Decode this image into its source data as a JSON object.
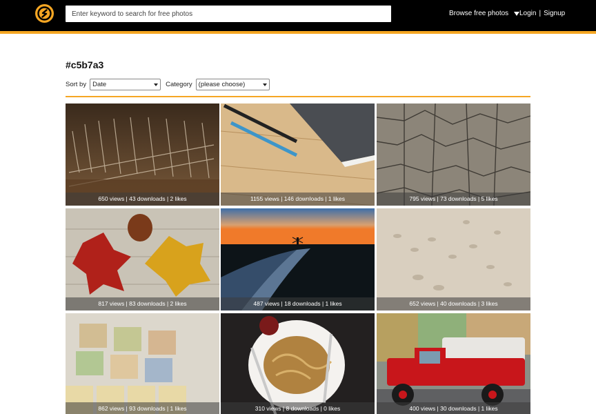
{
  "header": {
    "search_placeholder": "Enter keyword to search for free photos",
    "browse_label": "Browse free photos",
    "login_label": "Login",
    "separator": "|",
    "signup_label": "Signup"
  },
  "page": {
    "title": "#c5b7a3"
  },
  "filters": {
    "sort_label": "Sort by",
    "sort_value": "Date",
    "category_label": "Category",
    "category_value": "(please choose)"
  },
  "photos": [
    {
      "caption": "650 views | 43 downloads | 2 likes"
    },
    {
      "caption": "1155 views | 146 downloads | 1 likes"
    },
    {
      "caption": "795 views | 73 downloads | 5 likes"
    },
    {
      "caption": "817 views | 83 downloads | 2 likes"
    },
    {
      "caption": "487 views | 18 downloads | 1 likes"
    },
    {
      "caption": "652 views | 40 downloads | 3 likes"
    },
    {
      "caption": "862 views | 93 downloads | 1 likes"
    },
    {
      "caption": "310 views | 8 downloads | 0 likes"
    },
    {
      "caption": "400 views | 30 downloads | 1 likes"
    }
  ],
  "colors": {
    "header_bg": "#000000",
    "accent": "#f5a623"
  }
}
